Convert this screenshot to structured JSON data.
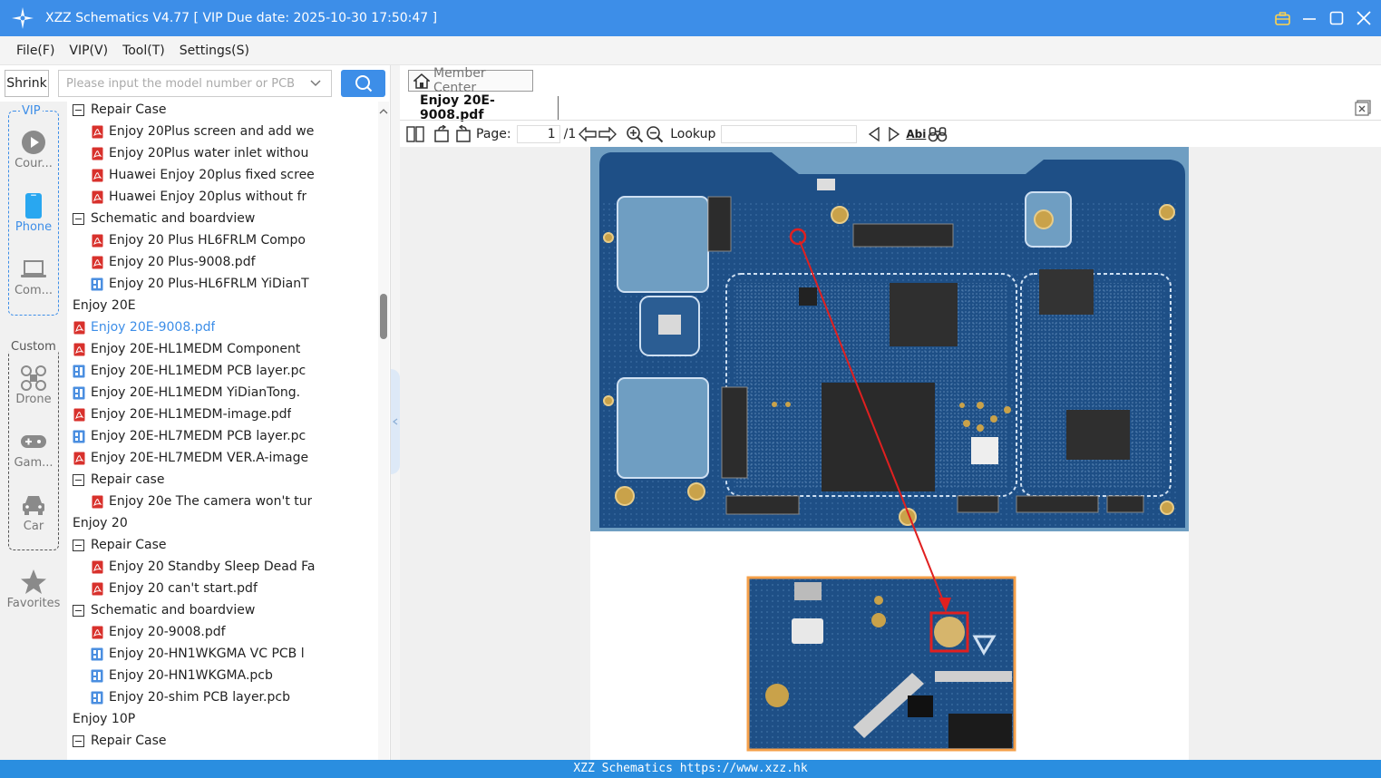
{
  "window": {
    "title": "XZZ Schematics V4.77 [ VIP Due date: 2025-10-30 17:50:47 ]"
  },
  "menu": [
    "File(F)",
    "VIP(V)",
    "Tool(T)",
    "Settings(S)"
  ],
  "search": {
    "shrink_label": "Shrink",
    "placeholder": "Please input the model number or PCB"
  },
  "rail": {
    "vip_label": "VIP",
    "custom_label": "Custom",
    "items": [
      "Cour...",
      "Phone",
      "Com...",
      "Drone",
      "Gam...",
      "Car",
      "Favorites"
    ]
  },
  "tree": [
    "Repair Case",
    "Enjoy 20Plus screen and add we",
    "Enjoy 20Plus water inlet withou",
    "Huawei Enjoy 20plus fixed scree",
    "Huawei Enjoy 20plus without fr",
    "Schematic and boardview",
    "Enjoy 20 Plus HL6FRLM Compo",
    "Enjoy 20 Plus-9008.pdf",
    "Enjoy 20 Plus-HL6FRLM YiDianT",
    "Enjoy 20E",
    "Enjoy 20E-9008.pdf",
    "Enjoy 20E-HL1MEDM Component",
    "Enjoy 20E-HL1MEDM PCB layer.pc",
    "Enjoy 20E-HL1MEDM YiDianTong.",
    "Enjoy 20E-HL1MEDM-image.pdf",
    "Enjoy 20E-HL7MEDM PCB layer.pc",
    "Enjoy 20E-HL7MEDM VER.A-image",
    "Repair case",
    "Enjoy 20e The camera won't tur",
    "Enjoy 20",
    "Repair Case",
    "Enjoy 20 Standby Sleep Dead Fa",
    "Enjoy 20 can't start.pdf",
    "Schematic and boardview",
    "Enjoy 20-9008.pdf",
    "Enjoy 20-HN1WKGMA VC PCB l",
    "Enjoy 20-HN1WKGMA.pcb",
    "Enjoy 20-shim PCB layer.pcb",
    "Enjoy 10P",
    "Repair Case"
  ],
  "viewer": {
    "member_center": "Member Center",
    "tab_title": "Enjoy 20E-9008.pdf",
    "page_label": "Page:",
    "page_value": "1",
    "page_total": "/1",
    "lookup_label": "Lookup",
    "abi": "Abi"
  },
  "status": {
    "text": "XZZ Schematics https://www.xzz.hk"
  },
  "colors": {
    "accent": "#3d8ee8",
    "pcb": "#1e4f86",
    "annotation": "#e02020"
  }
}
